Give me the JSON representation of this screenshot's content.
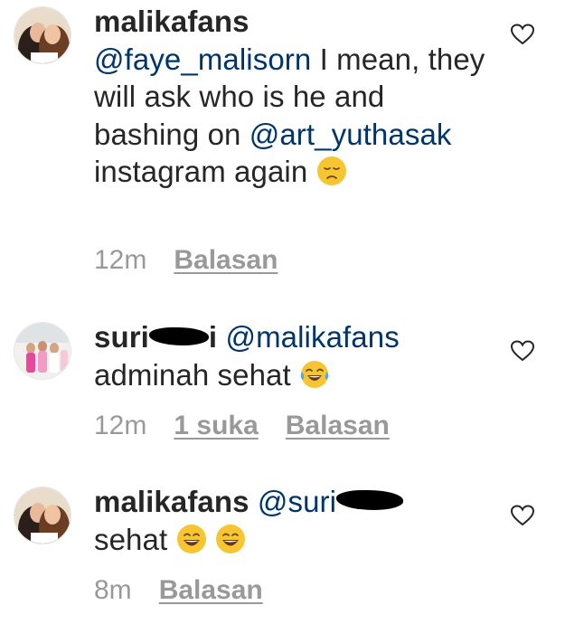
{
  "comments": [
    {
      "username": "malikafans",
      "mention_1": "@faye_malisorn",
      "text_1": " I mean, they will ask who is he and bashing on ",
      "mention_2": "@art_yuthasak",
      "text_2": " instagram again ",
      "emoji": "disappointed-face",
      "time": "12m",
      "reply_label": "Balasan"
    },
    {
      "username": "suri",
      "username_end": "i",
      "mention": "@malikafans",
      "text": "adminah sehat ",
      "emoji": "tears-of-joy-face",
      "time": "12m",
      "likes_label": "1 suka",
      "reply_label": "Balasan"
    },
    {
      "username": "malikafans",
      "mention": "@suri",
      "text": "sehat ",
      "emojis": [
        "grinning-face",
        "grinning-face"
      ],
      "time": "8m",
      "reply_label": "Balasan"
    }
  ],
  "colors": {
    "text": "#262626",
    "mention": "#003569",
    "meta": "#999999"
  }
}
